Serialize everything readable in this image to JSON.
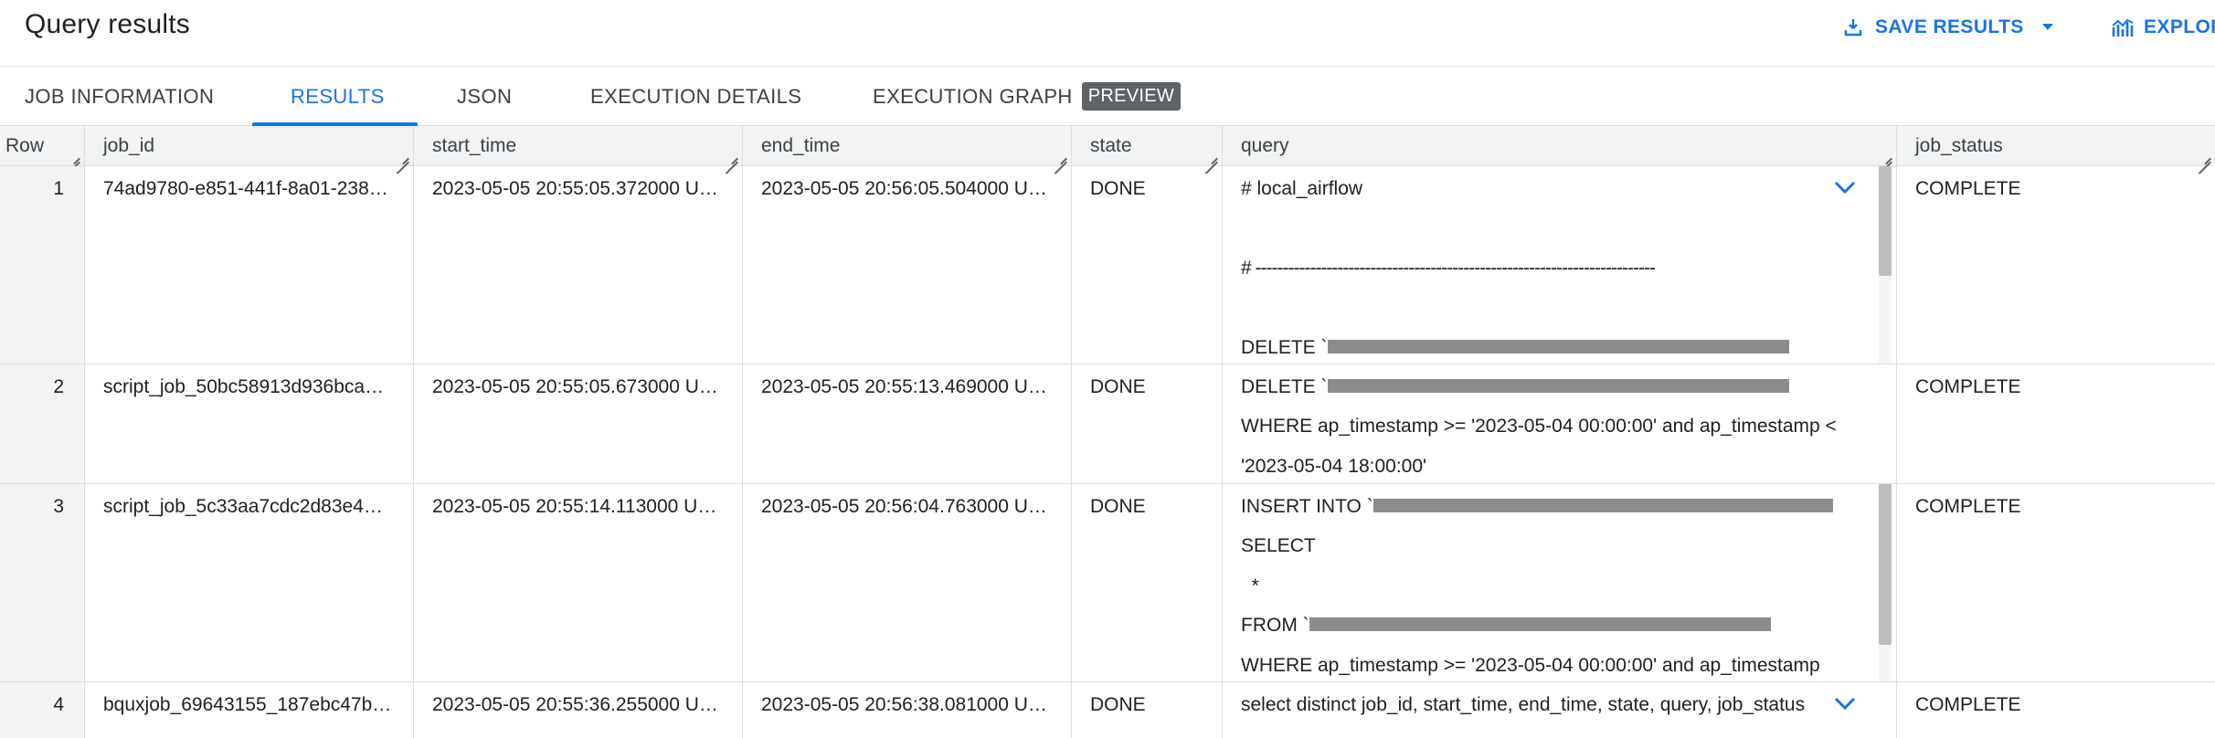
{
  "header": {
    "title": "Query results",
    "save_label": "SAVE RESULTS",
    "explore_label": "EXPLORE"
  },
  "tabs": [
    {
      "label": "JOB INFORMATION"
    },
    {
      "label": "RESULTS",
      "active": true
    },
    {
      "label": "JSON"
    },
    {
      "label": "EXECUTION DETAILS"
    },
    {
      "label": "EXECUTION GRAPH",
      "badge": "PREVIEW"
    }
  ],
  "table": {
    "columns": [
      "Row",
      "job_id",
      "start_time",
      "end_time",
      "state",
      "query",
      "job_status"
    ],
    "rows": [
      {
        "row": "1",
        "job_id": "74ad9780-e851-441f-8a01-238…",
        "start_time": "2023-05-05 20:55:05.372000 U…",
        "end_time": "2023-05-05 20:56:05.504000 U…",
        "state": "DONE",
        "query_lines": [
          "# local_airflow",
          "",
          "# -------------------------------------------------------------------------",
          "",
          "DELETE `"
        ],
        "job_status": "COMPLETE"
      },
      {
        "row": "2",
        "job_id": "script_job_50bc58913d936bca…",
        "start_time": "2023-05-05 20:55:05.673000 U…",
        "end_time": "2023-05-05 20:55:13.469000 U…",
        "state": "DONE",
        "query_lines": [
          "DELETE `",
          "WHERE ap_timestamp >= '2023-05-04 00:00:00' and ap_timestamp <",
          "'2023-05-04 18:00:00'"
        ],
        "job_status": "COMPLETE"
      },
      {
        "row": "3",
        "job_id": "script_job_5c33aa7cdc2d83e4…",
        "start_time": "2023-05-05 20:55:14.113000 U…",
        "end_time": "2023-05-05 20:56:04.763000 U…",
        "state": "DONE",
        "query_lines": [
          "INSERT INTO `",
          "SELECT",
          "  *",
          "FROM `",
          "WHERE ap_timestamp >= '2023-05-04 00:00:00' and ap_timestamp"
        ],
        "job_status": "COMPLETE"
      },
      {
        "row": "4",
        "job_id": "bquxjob_69643155_187ebc47b…",
        "start_time": "2023-05-05 20:55:36.255000 U…",
        "end_time": "2023-05-05 20:56:38.081000 U…",
        "state": "DONE",
        "query_lines": [
          "select distinct job_id, start_time, end_time, state, query, job_status"
        ],
        "job_status": "COMPLETE"
      }
    ]
  },
  "colors": {
    "accent": "#1a73e8",
    "badge_bg": "#5f6368",
    "header_bg": "#f1f3f4",
    "redaction": "#8c8c8c"
  },
  "icons": {
    "save": "download-icon",
    "save_menu": "caret-down-icon",
    "explore": "chart-icon",
    "expand": "chevron-down-icon"
  }
}
